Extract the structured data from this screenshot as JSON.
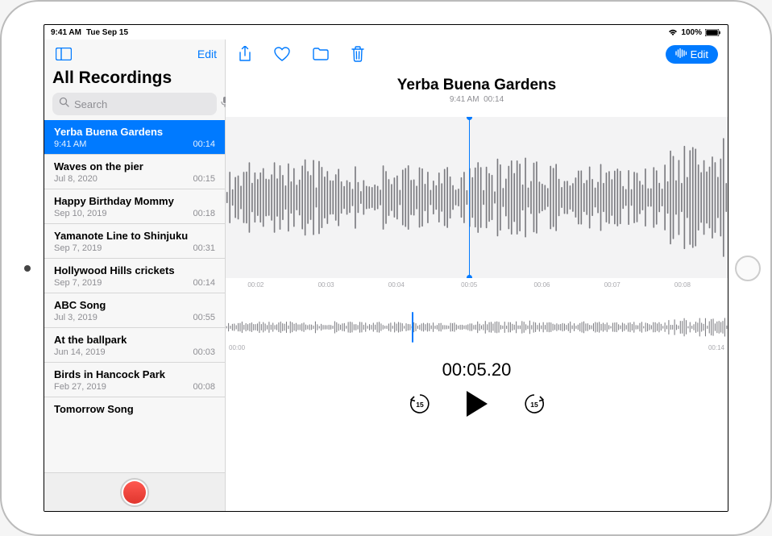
{
  "status": {
    "time": "9:41 AM",
    "date": "Tue Sep 15",
    "battery": "100%"
  },
  "sidebar": {
    "edit_label": "Edit",
    "title": "All Recordings",
    "search_placeholder": "Search",
    "recordings": [
      {
        "title": "Yerba Buena Gardens",
        "date": "9:41 AM",
        "duration": "00:14",
        "selected": true
      },
      {
        "title": "Waves on the pier",
        "date": "Jul 8, 2020",
        "duration": "00:15",
        "selected": false
      },
      {
        "title": "Happy Birthday Mommy",
        "date": "Sep 10, 2019",
        "duration": "00:18",
        "selected": false
      },
      {
        "title": "Yamanote Line to Shinjuku",
        "date": "Sep 7, 2019",
        "duration": "00:31",
        "selected": false
      },
      {
        "title": "Hollywood Hills crickets",
        "date": "Sep 7, 2019",
        "duration": "00:14",
        "selected": false
      },
      {
        "title": "ABC Song",
        "date": "Jul 3, 2019",
        "duration": "00:55",
        "selected": false
      },
      {
        "title": "At the ballpark",
        "date": "Jun 14, 2019",
        "duration": "00:03",
        "selected": false
      },
      {
        "title": "Birds in Hancock Park",
        "date": "Feb 27, 2019",
        "duration": "00:08",
        "selected": false
      },
      {
        "title": "Tomorrow Song",
        "date": "",
        "duration": "",
        "selected": false
      }
    ]
  },
  "main": {
    "edit_label": "Edit",
    "title": "Yerba Buena Gardens",
    "sub_time": "9:41 AM",
    "sub_duration": "00:14",
    "ruler_labels": [
      "00:02",
      "00:03",
      "00:04",
      "00:05",
      "00:06",
      "00:07",
      "00:08"
    ],
    "overview_start": "00:00",
    "overview_end": "00:14",
    "current_time": "00:05.20",
    "skip_amount": "15"
  }
}
